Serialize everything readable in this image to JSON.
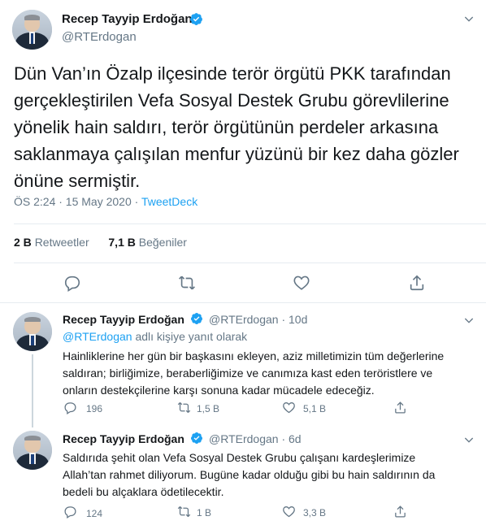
{
  "main_tweet": {
    "name": "Recep Tayyip Erdoğan",
    "handle": "@RTErdogan",
    "text_lines": [
      "Dün Van’ın Özalp ilçesinde terör örgütü PKK tarafından",
      "gerçekleştirilen Vefa Sosyal Destek Grubu görevlilerine",
      "yönelik hain saldırı, terör örgütünün perdeler arkasına",
      "saklanmaya çalışılan menfur yüzünü bir kez daha gözler",
      "önüne sermiştir."
    ],
    "time": "ÖS 2:24 · 15 May 2020 · ",
    "source": "TweetDeck",
    "retweets_count": "2 B",
    "retweets_label": "Retweetler",
    "likes_count": "7,1 B",
    "likes_label": "Beğeniler"
  },
  "replies": [
    {
      "name": "Recep Tayyip Erdoğan",
      "handle": "@RTErdogan · 10d",
      "reply_mention": "@RTErdogan",
      "reply_suffix": " adlı kişiye yanıt olarak",
      "text_lines": [
        "Hainliklerine her gün bir başkasını ekleyen, aziz milletimizin tüm değerlerine",
        "saldıran; birliğimize, beraberliğimize ve canımıza kast eden teröristlere ve",
        "onların destekçilerine karşı sonuna kadar mücadele edeceğiz."
      ],
      "replies_count": "196",
      "retweets_count": "1,5 B",
      "likes_count": "5,1 B"
    },
    {
      "name": "Recep Tayyip Erdoğan",
      "handle": "@RTErdogan · 6d",
      "text_lines": [
        "Saldırıda şehit olan Vefa Sosyal Destek Grubu çalışanı kardeşlerimize",
        "Allah’tan rahmet diliyorum. Bugüne kadar olduğu gibi bu hain saldırının da",
        "bedeli bu alçaklara ödetilecektir."
      ],
      "replies_count": "124",
      "retweets_count": "1 B",
      "likes_count": "3,3 B"
    }
  ],
  "icons": {
    "verified": "verified-badge-icon",
    "more": "chevron-down-icon",
    "reply": "reply-icon",
    "retweet": "retweet-icon",
    "like": "heart-icon",
    "share": "share-icon"
  },
  "colors": {
    "accent": "#1da1f2",
    "text": "#14171a",
    "secondary": "#657786",
    "divider": "#e6ecf0"
  }
}
